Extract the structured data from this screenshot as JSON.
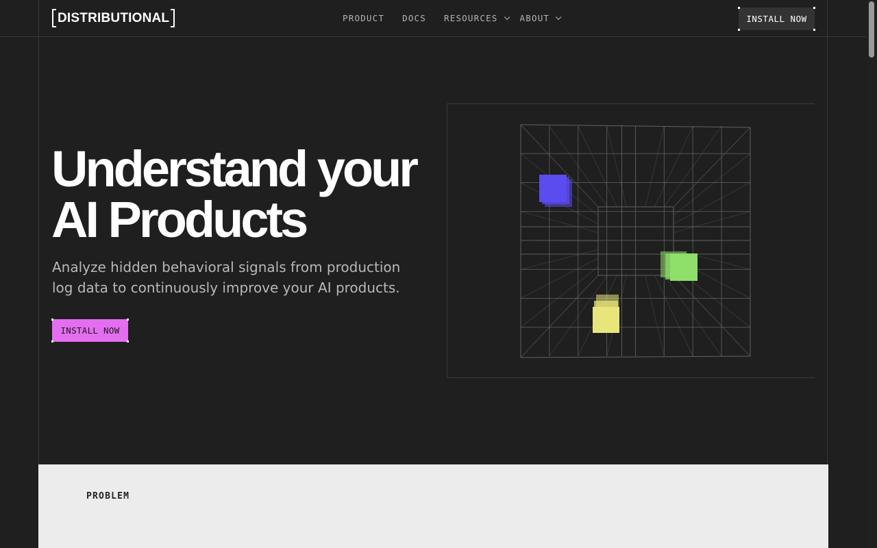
{
  "brand": {
    "logo_text": "DISTRIBUTIONAL"
  },
  "nav": {
    "items": [
      {
        "label": "PRODUCT",
        "has_dropdown": false
      },
      {
        "label": "DOCS",
        "has_dropdown": false
      },
      {
        "label": "RESOURCES",
        "has_dropdown": true
      },
      {
        "label": "ABOUT",
        "has_dropdown": true
      }
    ],
    "cta_label": "INSTALL NOW"
  },
  "hero": {
    "title_line1": "Understand your",
    "title_line2": "AI Products",
    "subtitle": "Analyze hidden behavioral signals from production log data to continuously improve your AI products.",
    "cta_label": "INSTALL NOW"
  },
  "visualization": {
    "name": "3d-grid-cube",
    "cube_colors": {
      "blue": "#5b4cf0",
      "green": "#8fe06a",
      "yellow": "#e8e67a"
    }
  },
  "section_problem": {
    "eyebrow": "PROBLEM"
  },
  "colors": {
    "background": "#1f1f1f",
    "accent": "#e46ef0",
    "lower_section_bg": "#ececec",
    "button_dark": "#333333"
  }
}
